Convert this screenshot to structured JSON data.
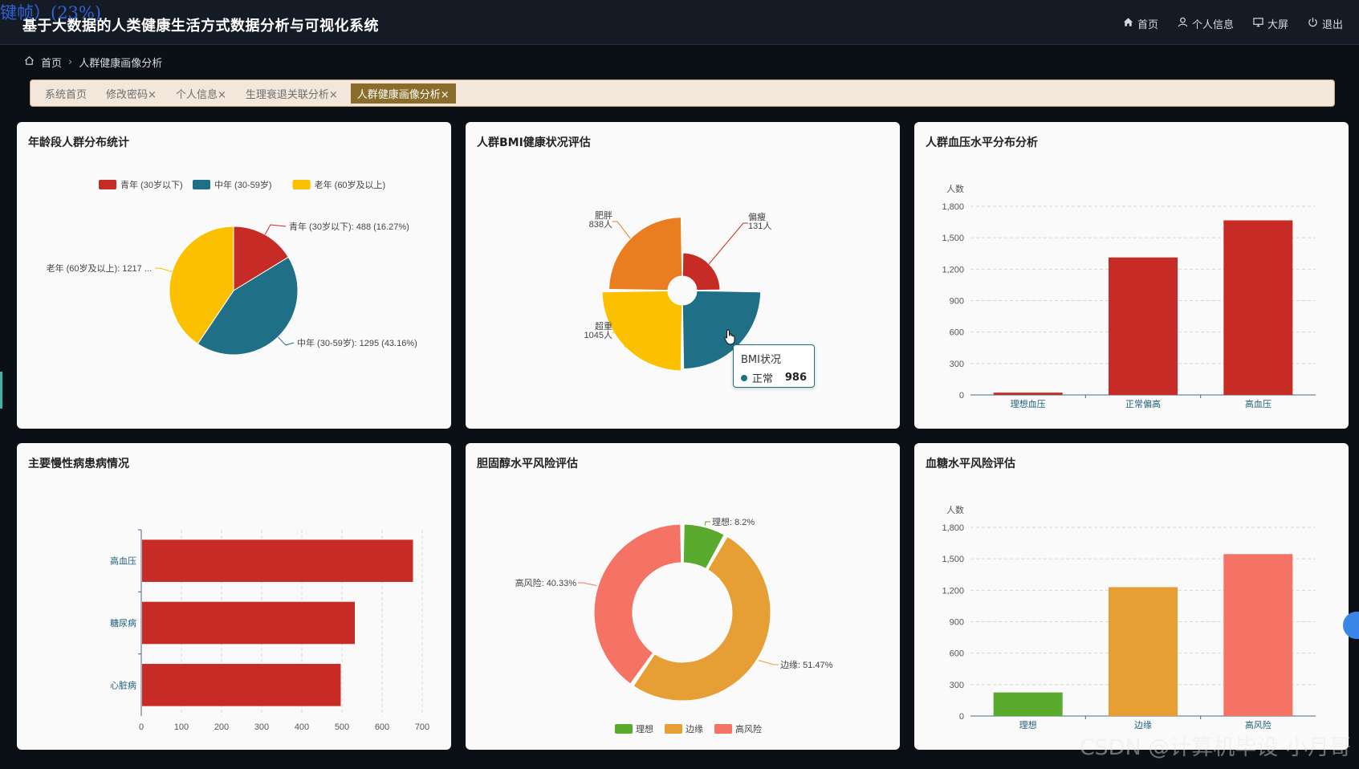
{
  "overlay": {
    "text": "键帧）(23%)"
  },
  "header": {
    "title": "基于大数据的人类健康生活方式数据分析与可视化系统",
    "nav": [
      {
        "label": "首页",
        "icon": "home-icon"
      },
      {
        "label": "个人信息",
        "icon": "user-icon"
      },
      {
        "label": "大屏",
        "icon": "monitor-icon"
      },
      {
        "label": "退出",
        "icon": "power-icon"
      }
    ]
  },
  "breadcrumb": {
    "home": "首页",
    "current": "人群健康画像分析"
  },
  "tags": [
    {
      "label": "系统首页",
      "closable": false,
      "active": false
    },
    {
      "label": "修改密码",
      "closable": true,
      "active": false
    },
    {
      "label": "个人信息",
      "closable": true,
      "active": false
    },
    {
      "label": "生理衰退关联分析",
      "closable": true,
      "active": false
    },
    {
      "label": "人群健康画像分析",
      "closable": true,
      "active": true
    }
  ],
  "close_glyph": "×",
  "panels": {
    "age": {
      "title": "年龄段人群分布统计"
    },
    "bmi": {
      "title": "人群BMI健康状况评估"
    },
    "bp": {
      "title": "人群血压水平分布分析"
    },
    "chronic": {
      "title": "主要慢性病患病情况"
    },
    "chol": {
      "title": "胆固醇水平风险评估"
    },
    "glucose": {
      "title": "血糖水平风险评估"
    }
  },
  "tooltip": {
    "title": "BMI状况",
    "name": "正常",
    "value": "986"
  },
  "watermark": "CSDN @计算机毕设-小月哥",
  "colors": {
    "red": "#c62c25",
    "teal": "#1f6f86",
    "yellow": "#fbc100",
    "orange": "#ea7d20",
    "green": "#5aaa2e",
    "amber": "#e69f35",
    "salmon": "#f57365"
  },
  "chart_data": [
    {
      "type": "pie",
      "title": "年龄段人群分布统计",
      "legend": [
        "青年 (30岁以下)",
        "中年 (30-59岁)",
        "老年 (60岁及以上)"
      ],
      "legend_position": "top",
      "slices": [
        {
          "name": "青年 (30岁以下)",
          "value": 488,
          "percent": 16.27,
          "label": "青年 (30岁以下): 488 (16.27%)",
          "color": "#c62c25"
        },
        {
          "name": "中年 (30-59岁)",
          "value": 1295,
          "percent": 43.16,
          "label": "中年 (30-59岁): 1295 (43.16%)",
          "color": "#1f6f86"
        },
        {
          "name": "老年 (60岁及以上)",
          "value": 1217,
          "label": "老年 (60岁及以上): 1217 ...",
          "color": "#fbc100"
        }
      ]
    },
    {
      "type": "pie",
      "subtype": "rose",
      "title": "人群BMI健康状况评估",
      "slices": [
        {
          "name": "偏瘦",
          "value": 131,
          "label": [
            "偏瘦",
            "131人"
          ],
          "color": "#c62c25"
        },
        {
          "name": "正常",
          "value": 986,
          "color": "#1f6f86"
        },
        {
          "name": "超重",
          "value": 1045,
          "label": [
            "超重",
            "1045人"
          ],
          "color": "#fbc100"
        },
        {
          "name": "肥胖",
          "value": 838,
          "label": [
            "肥胖",
            "838人"
          ],
          "color": "#ea7d20"
        }
      ]
    },
    {
      "type": "bar",
      "title": "人群血压水平分布分析",
      "categories": [
        "理想血压",
        "正常偏高",
        "高血压"
      ],
      "values": [
        22,
        1312,
        1666
      ],
      "ylabel": "人数",
      "ylim": [
        0,
        1800
      ],
      "yticks": [
        "0",
        "300",
        "600",
        "900",
        "1,200",
        "1,500",
        "1,800"
      ],
      "grid": true
    },
    {
      "type": "bar",
      "orientation": "horizontal",
      "title": "主要慢性病患病情况",
      "categories": [
        "高血压",
        "糖尿病",
        "心脏病"
      ],
      "values": [
        675,
        530,
        495
      ],
      "xlim": [
        0,
        700
      ],
      "xticks": [
        "0",
        "100",
        "200",
        "300",
        "400",
        "500",
        "600",
        "700"
      ],
      "grid": true
    },
    {
      "type": "pie",
      "subtype": "donut",
      "title": "胆固醇水平风险评估",
      "legend": [
        "理想",
        "边缘",
        "高风险"
      ],
      "legend_position": "bottom",
      "slices": [
        {
          "name": "理想",
          "percent": 8.2,
          "label": "理想: 8.2%",
          "color": "#5aaa2e"
        },
        {
          "name": "边缘",
          "percent": 51.47,
          "label": "边缘: 51.47%",
          "color": "#e69f35"
        },
        {
          "name": "高风险",
          "percent": 40.33,
          "label": "高风险: 40.33%",
          "color": "#f57365"
        }
      ]
    },
    {
      "type": "bar",
      "title": "血糖水平风险评估",
      "categories": [
        "理想",
        "边缘",
        "高风险"
      ],
      "values": [
        225,
        1230,
        1545
      ],
      "colors": [
        "#5aaa2e",
        "#e69f35",
        "#f57365"
      ],
      "ylabel": "人数",
      "ylim": [
        0,
        1800
      ],
      "yticks": [
        "0",
        "300",
        "600",
        "900",
        "1,200",
        "1,500",
        "1,800"
      ],
      "grid": true
    }
  ]
}
